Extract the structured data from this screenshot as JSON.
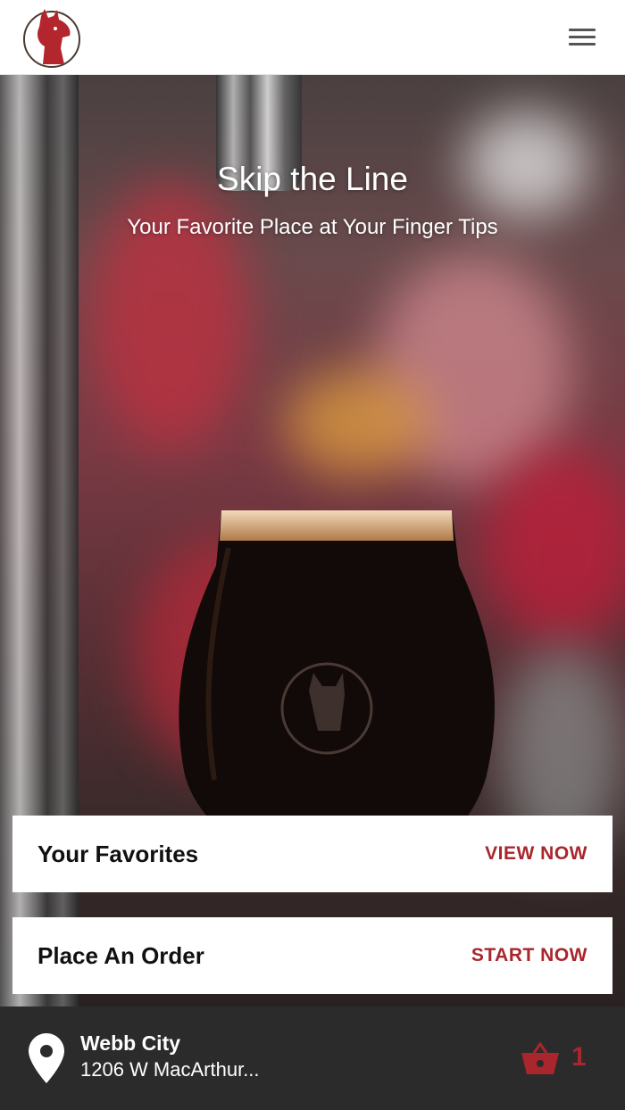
{
  "header": {
    "logo_icon": "llama-logo-icon",
    "menu_icon": "hamburger-menu-icon"
  },
  "hero": {
    "title": "Skip the Line",
    "subtitle": "Your Favorite Place at Your Finger Tips"
  },
  "cards": {
    "favorites": {
      "label": "Your Favorites",
      "action": "VIEW NOW"
    },
    "order": {
      "label": "Place An Order",
      "action": "START NOW"
    }
  },
  "footer": {
    "location_icon": "map-pin-icon",
    "location_name": "Webb City",
    "location_address": "1206 W MacArthur...",
    "cart_icon": "basket-icon",
    "cart_count": "1"
  },
  "colors": {
    "accent": "#a8262c",
    "footer_bg": "#2b2b2b",
    "header_bg": "#ffffff"
  }
}
